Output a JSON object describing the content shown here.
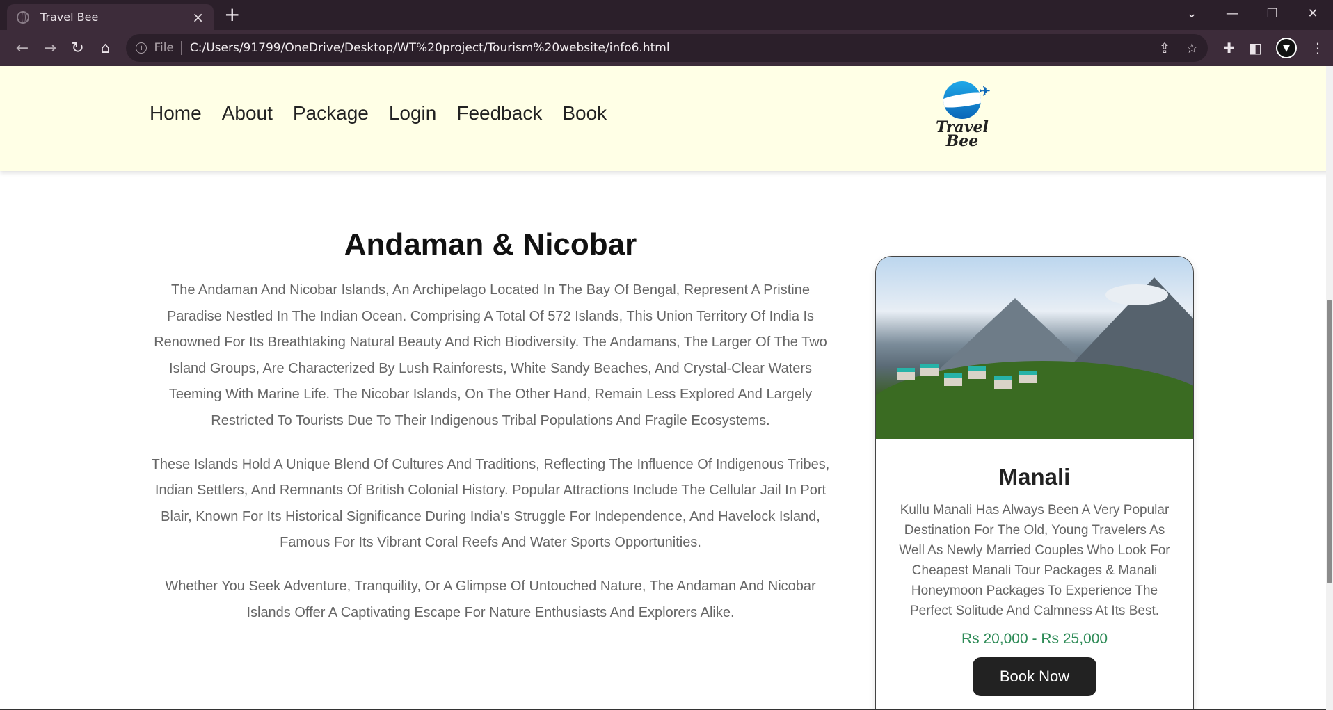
{
  "browser": {
    "tab_title": "Travel Bee",
    "tab_close": "×",
    "new_tab": "+",
    "window_controls": [
      "⌄",
      "—",
      "❐",
      "✕"
    ],
    "address_scheme": "File",
    "address_url": "C:/Users/91799/OneDrive/Desktop/WT%20project/Tourism%20website/info6.html",
    "icons": [
      "back-icon",
      "forward-icon",
      "reload-icon",
      "home-icon",
      "share-icon",
      "star-icon",
      "extensions-icon",
      "sidepanel-icon",
      "profile-icon",
      "kebab-menu-icon"
    ]
  },
  "header": {
    "nav": [
      "Home",
      "About",
      "Package",
      "Login",
      "Feedback",
      "Book"
    ],
    "logo_line1": "Travel",
    "logo_line2": "Bee"
  },
  "article": {
    "title": "Andaman & Nicobar",
    "paragraphs": [
      "The Andaman And Nicobar Islands, An Archipelago Located In The Bay Of Bengal, Represent A Pristine Paradise Nestled In The Indian Ocean. Comprising A Total Of 572 Islands, This Union Territory Of India Is Renowned For Its Breathtaking Natural Beauty And Rich Biodiversity. The Andamans, The Larger Of The Two Island Groups, Are Characterized By Lush Rainforests, White Sandy Beaches, And Crystal-Clear Waters Teeming With Marine Life. The Nicobar Islands, On The Other Hand, Remain Less Explored And Largely Restricted To Tourists Due To Their Indigenous Tribal Populations And Fragile Ecosystems.",
      "These Islands Hold A Unique Blend Of Cultures And Traditions, Reflecting The Influence Of Indigenous Tribes, Indian Settlers, And Remnants Of British Colonial History. Popular Attractions Include The Cellular Jail In Port Blair, Known For Its Historical Significance During India's Struggle For Independence, And Havelock Island, Famous For Its Vibrant Coral Reefs And Water Sports Opportunities.",
      "Whether You Seek Adventure, Tranquility, Or A Glimpse Of Untouched Nature, The Andaman And Nicobar Islands Offer A Captivating Escape For Nature Enthusiasts And Explorers Alike."
    ]
  },
  "card": {
    "title": "Manali",
    "description": "Kullu Manali Has Always Been A Very Popular Destination For The Old, Young Travelers As Well As Newly Married Couples Who Look For Cheapest Manali Tour Packages & Manali Honeymoon Packages To Experience The Perfect Solitude And Calmness At Its Best.",
    "price": "Rs 20,000 - Rs 25,000",
    "button": "Book Now",
    "price_color": "#2e8b57"
  }
}
